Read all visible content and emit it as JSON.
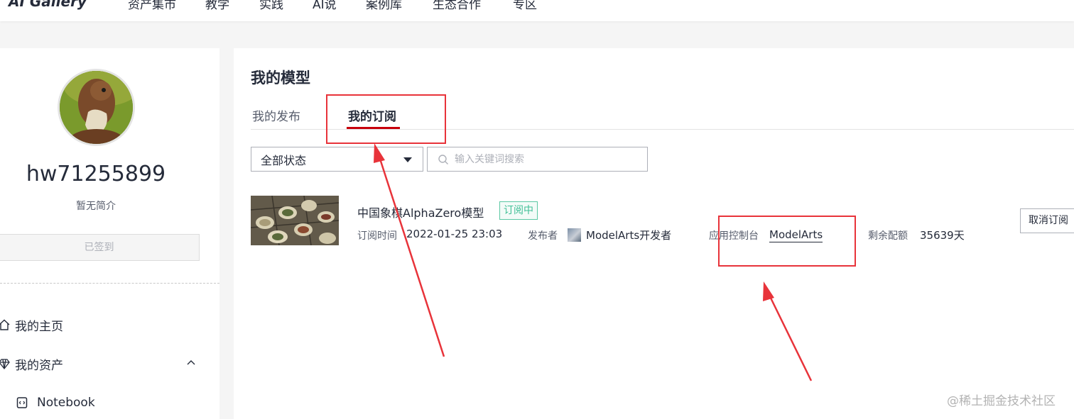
{
  "topnav": {
    "logo": "AI Gallery",
    "items": [
      "资产集市",
      "教学",
      "实践",
      "AI说",
      "案例库",
      "生态合作",
      "专区"
    ]
  },
  "sidebar": {
    "username": "hw71255899",
    "bio": "暂无简介",
    "signin_label": "已签到",
    "menu": [
      {
        "label": "我的主页",
        "icon": "home-icon"
      },
      {
        "label": "我的资产",
        "icon": "diamond-icon"
      },
      {
        "label": "Notebook",
        "icon": "notebook-icon"
      }
    ]
  },
  "main": {
    "title": "我的模型",
    "tabs": [
      {
        "label": "我的发布",
        "active": false
      },
      {
        "label": "我的订阅",
        "active": true
      }
    ],
    "filter": {
      "status_value": "全部状态",
      "search_placeholder": "输入关键词搜索"
    },
    "subscriptions": [
      {
        "name": "中国象棋AlphaZero模型",
        "badge": "订阅中",
        "subscribe_time_label": "订阅时间",
        "subscribe_time": "2022-01-25 23:03",
        "publisher_label": "发布者",
        "publisher": "ModelArts开发者",
        "console_label": "应用控制台",
        "console_link": "ModelArts",
        "quota_label": "剩余配额",
        "quota_value": "35639天",
        "action_label": "取消订阅"
      }
    ]
  },
  "watermark": "@稀土掘金技术社区",
  "colors": {
    "accent": "#c7000b",
    "annotation": "#e8333a",
    "badge": "#3fbf96"
  }
}
